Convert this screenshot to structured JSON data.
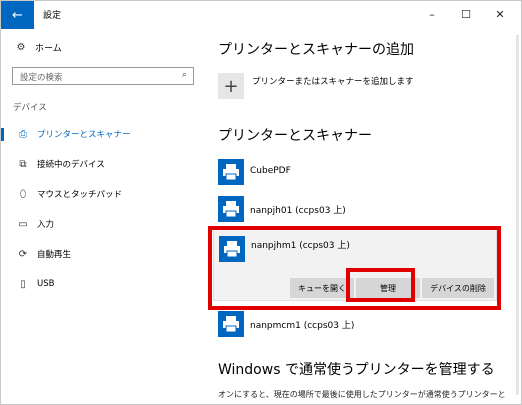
{
  "window": {
    "title": "設定",
    "back_glyph": "←",
    "minimize": "–",
    "maximize": "☐",
    "close": "✕"
  },
  "sidebar": {
    "home": "ホーム",
    "search_placeholder": "設定の検索",
    "section": "デバイス",
    "items": [
      {
        "label": "プリンターとスキャナー",
        "icon": "printer-icon",
        "glyph": "⎙",
        "active": true
      },
      {
        "label": "接続中のデバイス",
        "icon": "devices-icon",
        "glyph": "⧉",
        "active": false
      },
      {
        "label": "マウスとタッチパッド",
        "icon": "mouse-icon",
        "glyph": "⬯",
        "active": false
      },
      {
        "label": "入力",
        "icon": "keyboard-icon",
        "glyph": "▭",
        "active": false
      },
      {
        "label": "自動再生",
        "icon": "autoplay-icon",
        "glyph": "⟳",
        "active": false
      },
      {
        "label": "USB",
        "icon": "usb-icon",
        "glyph": "▯",
        "active": false
      }
    ]
  },
  "main": {
    "add_heading": "プリンターとスキャナーの追加",
    "add_label": "プリンターまたはスキャナーを追加します",
    "printers_heading": "プリンターとスキャナー",
    "printers": [
      {
        "name": "CubePDF"
      },
      {
        "name": "nanpjh01 (ccps03 上)"
      },
      {
        "name": "nanpjhm1 (ccps03 上)",
        "selected": true
      },
      {
        "name": "nanpmcm1 (ccps03 上)"
      }
    ],
    "buttons": {
      "queue": "キューを開く",
      "manage": "管理",
      "remove": "デバイスの削除"
    },
    "manage_heading": "Windows で通常使うプリンターを管理する",
    "manage_desc": "オンにすると、現在の場所で最後に使用したプリンターが通常使うプリンターと"
  },
  "colors": {
    "accent": "#0067c0",
    "highlight": "#e00000"
  }
}
